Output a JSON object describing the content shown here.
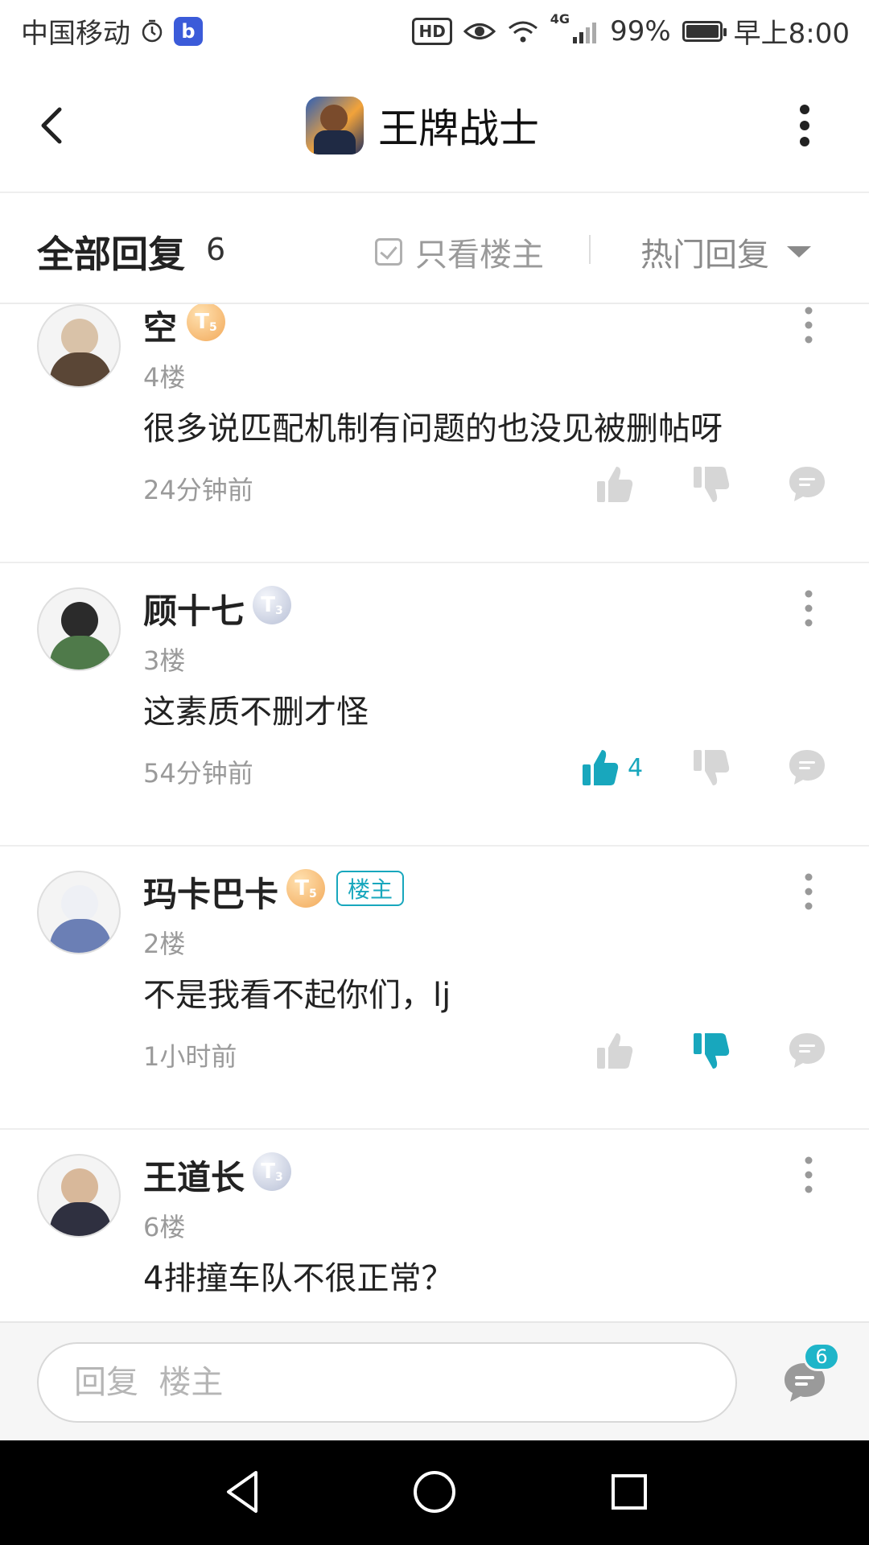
{
  "status_bar": {
    "carrier": "中国移动",
    "network": "4G",
    "battery": "99%",
    "time": "早上8:00",
    "hd": "HD"
  },
  "header": {
    "title": "王牌战士",
    "back_icon": "back-arrow-icon",
    "more_icon": "more-vertical-icon"
  },
  "replies_header": {
    "title": "全部回复",
    "count": "6",
    "only_op_label": "只看楼主",
    "sort_label": "热门回复"
  },
  "replies": [
    {
      "username": "空",
      "level": "T",
      "level_sub": "5",
      "level_style": "gold",
      "is_op": false,
      "floor": "4楼",
      "content": "很多说匹配机制有问题的也没见被删帖呀",
      "time": "24分钟前",
      "liked": false,
      "like_count": "",
      "disliked": false
    },
    {
      "username": "顾十七",
      "level": "T",
      "level_sub": "3",
      "level_style": "silver",
      "is_op": false,
      "floor": "3楼",
      "content": "这素质不删才怪",
      "time": "54分钟前",
      "liked": true,
      "like_count": "4",
      "disliked": false
    },
    {
      "username": "玛卡巴卡",
      "level": "T",
      "level_sub": "5",
      "level_style": "gold",
      "is_op": true,
      "op_badge": "楼主",
      "floor": "2楼",
      "content": "不是我看不起你们，lj",
      "time": "1小时前",
      "liked": false,
      "like_count": "",
      "disliked": true
    },
    {
      "username": "王道长",
      "level": "T",
      "level_sub": "3",
      "level_style": "silver",
      "is_op": false,
      "floor": "6楼",
      "content": "4排撞车队不很正常？",
      "time": "",
      "liked": false,
      "like_count": "",
      "disliked": false
    }
  ],
  "bottom_bar": {
    "input_placeholder": "回复  楼主",
    "comment_count": "6"
  },
  "colors": {
    "accent": "#18a7bd",
    "muted_text": "#9a9a9a",
    "icon_gray": "#d6d6d6"
  }
}
